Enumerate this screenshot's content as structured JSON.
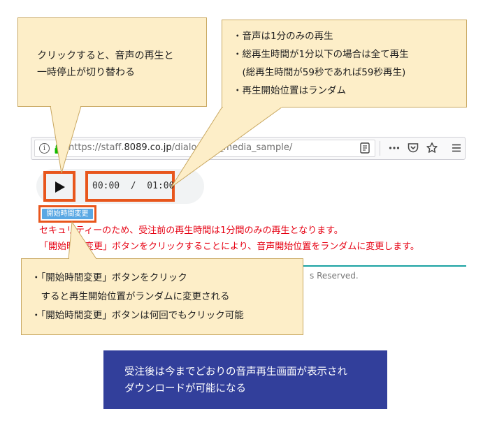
{
  "callouts": {
    "play_toggle": {
      "lines": [
        "クリックすると、音声の再生と",
        "一時停止が切り替わる"
      ]
    },
    "playback_rules": {
      "lines": [
        "・音声は1分のみの再生",
        "・総再生時間が1分以下の場合は全て再生",
        "　(総再生時間が59秒であれば59秒再生)",
        "・再生開始位置はランダム"
      ]
    },
    "change_button": {
      "lines": [
        "・「開始時間変更」ボタンをクリック",
        "　すると再生開始位置がランダムに変更される",
        "・「開始時間変更」ボタンは何回でもクリック可能"
      ]
    }
  },
  "browser": {
    "url_prefix": "https://staff.",
    "url_domain": "8089.co.jp",
    "url_path": "/dialo    play_media_sample/",
    "icons": [
      "info-icon",
      "lock-icon",
      "reader-view-icon",
      "more-icon",
      "pocket-icon",
      "bookmark-star-icon",
      "menu-icon"
    ]
  },
  "player": {
    "time_display": "00:00  /  01:00",
    "play_icon": "play-icon"
  },
  "page": {
    "change_button_label": "開始時間変更",
    "notice_1": "セキュリティーのため、受注前の再生時間は1分間のみの再生となります。",
    "notice_2": "「開始時間変更」ボタンをクリックすることにより、音声開始位置をランダムに変更します。",
    "footer": "s Reserved."
  },
  "summary_box": {
    "lines": [
      "受注後は今までどおりの音声再生画面が表示され",
      "ダウンロードが可能になる"
    ]
  },
  "colors": {
    "callout_bg": "#fdeec8",
    "highlight": "#e8561c",
    "notice_red": "#e60012",
    "summary_bg": "#323f9b",
    "button_blue": "#5aa8e4"
  }
}
